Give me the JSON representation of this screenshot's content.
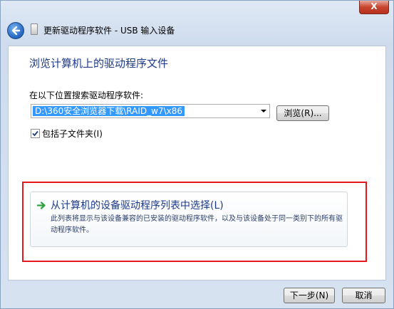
{
  "window": {
    "close_symbol": "X",
    "title": "更新驱动程序软件 - USB 输入设备"
  },
  "icons": {
    "back": "back-arrow-icon",
    "title": "device-icon",
    "pick_arrow": "green-arrow-icon"
  },
  "main": {
    "heading": "浏览计算机上的驱动程序文件",
    "location_label": "在以下位置搜索驱动程序软件:",
    "path_value": "D:\\360安全浏览器下载\\RAID_w7\\x86",
    "browse_label": "浏览(R)...",
    "include_subfolders_label": "包括子文件夹(I)",
    "include_subfolders_checked": true
  },
  "pick_option": {
    "title": "从计算机的设备驱动程序列表中选择(L)",
    "description": "此列表将显示与该设备兼容的已安装的驱动程序软件，以及与该设备处于同一类别下的所有驱动程序软件。"
  },
  "footer": {
    "next_label": "下一步(N)",
    "cancel_label": "取消"
  },
  "colors": {
    "accent": "#1e3a8a",
    "highlight": "#e8181f",
    "selection": "#3399ff"
  }
}
